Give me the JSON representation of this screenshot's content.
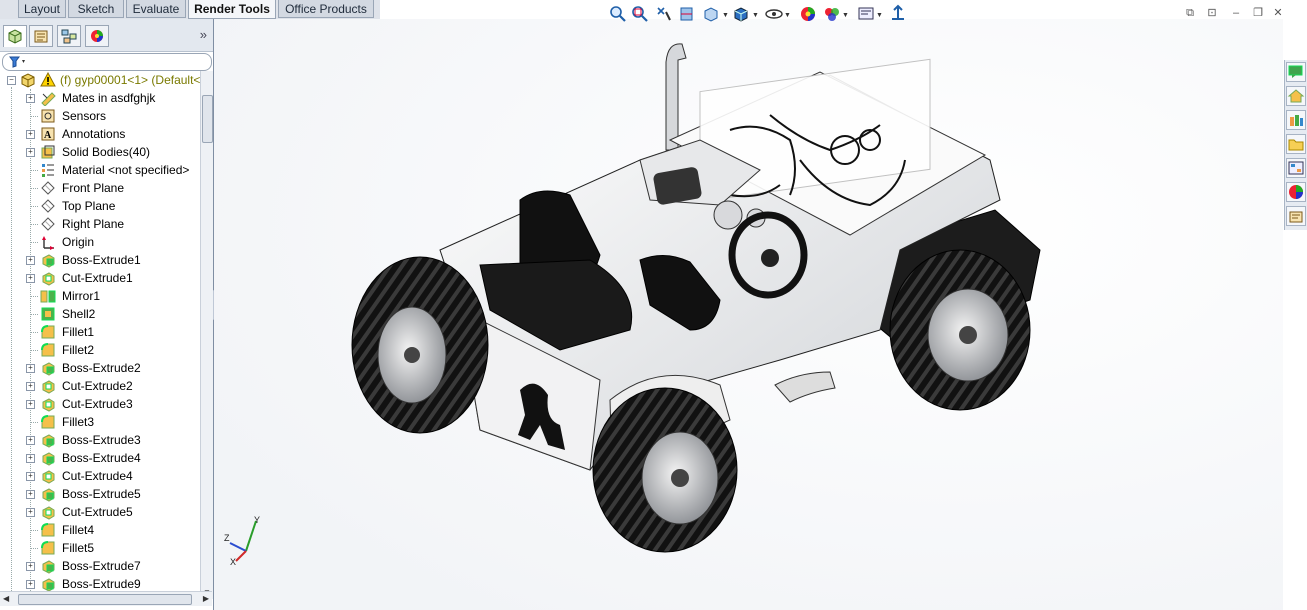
{
  "tabs": [
    "Layout",
    "Sketch",
    "Evaluate",
    "Render Tools",
    "Office Products"
  ],
  "active_tab": "Render Tools",
  "feature_tree": {
    "root": "(f) gyp00001<1> (Default<",
    "items": [
      {
        "label": "Mates in asdfghjk",
        "icon": "mates-icon",
        "expandable": true
      },
      {
        "label": "Sensors",
        "icon": "sensors-icon",
        "expandable": false
      },
      {
        "label": "Annotations",
        "icon": "annotations-icon",
        "expandable": true
      },
      {
        "label": "Solid Bodies(40)",
        "icon": "solid-bodies-icon",
        "expandable": true
      },
      {
        "label": "Material <not specified>",
        "icon": "material-icon",
        "expandable": false
      },
      {
        "label": "Front Plane",
        "icon": "plane-icon",
        "expandable": false
      },
      {
        "label": "Top Plane",
        "icon": "plane-icon",
        "expandable": false
      },
      {
        "label": "Right Plane",
        "icon": "plane-icon",
        "expandable": false
      },
      {
        "label": "Origin",
        "icon": "origin-icon",
        "expandable": false
      },
      {
        "label": "Boss-Extrude1",
        "icon": "boss-extrude-icon",
        "expandable": true
      },
      {
        "label": "Cut-Extrude1",
        "icon": "cut-extrude-icon",
        "expandable": true
      },
      {
        "label": "Mirror1",
        "icon": "mirror-icon",
        "expandable": false
      },
      {
        "label": "Shell2",
        "icon": "shell-icon",
        "expandable": false
      },
      {
        "label": "Fillet1",
        "icon": "fillet-icon",
        "expandable": false
      },
      {
        "label": "Fillet2",
        "icon": "fillet-icon",
        "expandable": false
      },
      {
        "label": "Boss-Extrude2",
        "icon": "boss-extrude-icon",
        "expandable": true
      },
      {
        "label": "Cut-Extrude2",
        "icon": "cut-extrude-icon",
        "expandable": true
      },
      {
        "label": "Cut-Extrude3",
        "icon": "cut-extrude-icon",
        "expandable": true
      },
      {
        "label": "Fillet3",
        "icon": "fillet-icon",
        "expandable": false
      },
      {
        "label": "Boss-Extrude3",
        "icon": "boss-extrude-icon",
        "expandable": true
      },
      {
        "label": "Boss-Extrude4",
        "icon": "boss-extrude-icon",
        "expandable": true
      },
      {
        "label": "Cut-Extrude4",
        "icon": "cut-extrude-icon",
        "expandable": true
      },
      {
        "label": "Boss-Extrude5",
        "icon": "boss-extrude-icon",
        "expandable": true
      },
      {
        "label": "Cut-Extrude5",
        "icon": "cut-extrude-icon",
        "expandable": true
      },
      {
        "label": "Fillet4",
        "icon": "fillet-icon",
        "expandable": false
      },
      {
        "label": "Fillet5",
        "icon": "fillet-icon",
        "expandable": false
      },
      {
        "label": "Boss-Extrude7",
        "icon": "boss-extrude-icon",
        "expandable": true
      },
      {
        "label": "Boss-Extrude9",
        "icon": "boss-extrude-icon",
        "expandable": true
      }
    ]
  },
  "fm_tabs": [
    "feature-manager-icon",
    "property-manager-icon",
    "configuration-manager-icon",
    "appearance-manager-icon"
  ],
  "view_toolbar": [
    "zoom-to-fit-icon",
    "zoom-to-area-icon",
    "previous-view-icon",
    "section-view-icon",
    "view-orientation-icon",
    "display-style-icon",
    "hide-show-items-icon",
    "edit-appearance-icon",
    "apply-scene-icon",
    "view-settings-icon",
    "realview-icon"
  ],
  "task_pane": [
    "resources-icon",
    "home-icon",
    "design-library-icon",
    "file-explorer-icon",
    "view-palette-icon",
    "appearances-icon",
    "custom-properties-icon"
  ],
  "triad": {
    "x": "X",
    "y": "Y",
    "z": "Z"
  },
  "colors": {
    "accent": "#1f5fa8",
    "panel": "#e3e8ef",
    "tree_root": "#7a7a00"
  }
}
